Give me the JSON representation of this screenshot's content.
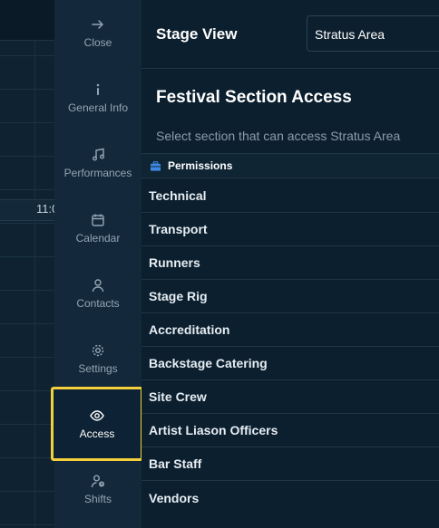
{
  "background": {
    "time_label": "11:0"
  },
  "sidebar": {
    "items": [
      {
        "label": "Close",
        "icon": "arrow-right-icon"
      },
      {
        "label": "General Info",
        "icon": "info-icon"
      },
      {
        "label": "Performances",
        "icon": "music-note-icon"
      },
      {
        "label": "Calendar",
        "icon": "calendar-icon"
      },
      {
        "label": "Contacts",
        "icon": "user-icon"
      },
      {
        "label": "Settings",
        "icon": "gear-icon"
      },
      {
        "label": "Access",
        "icon": "eye-icon",
        "active": true
      },
      {
        "label": "Shifts",
        "icon": "user-clock-icon"
      }
    ]
  },
  "header": {
    "stage_view_label": "Stage View",
    "stage_select_value": "Stratus Area"
  },
  "access": {
    "title": "Festival Section Access",
    "subtitle": "Select section that can access Stratus Area",
    "permissions_header": "Permissions",
    "sections": [
      "Technical",
      "Transport",
      "Runners",
      "Stage Rig",
      "Accreditation",
      "Backstage Catering",
      "Site Crew",
      "Artist Liason Officers",
      "Bar Staff",
      "Vendors"
    ]
  },
  "colors": {
    "sidebar_bg": "#13283a",
    "main_bg": "#0c1f2e",
    "active_highlight": "#f2cf3b"
  }
}
